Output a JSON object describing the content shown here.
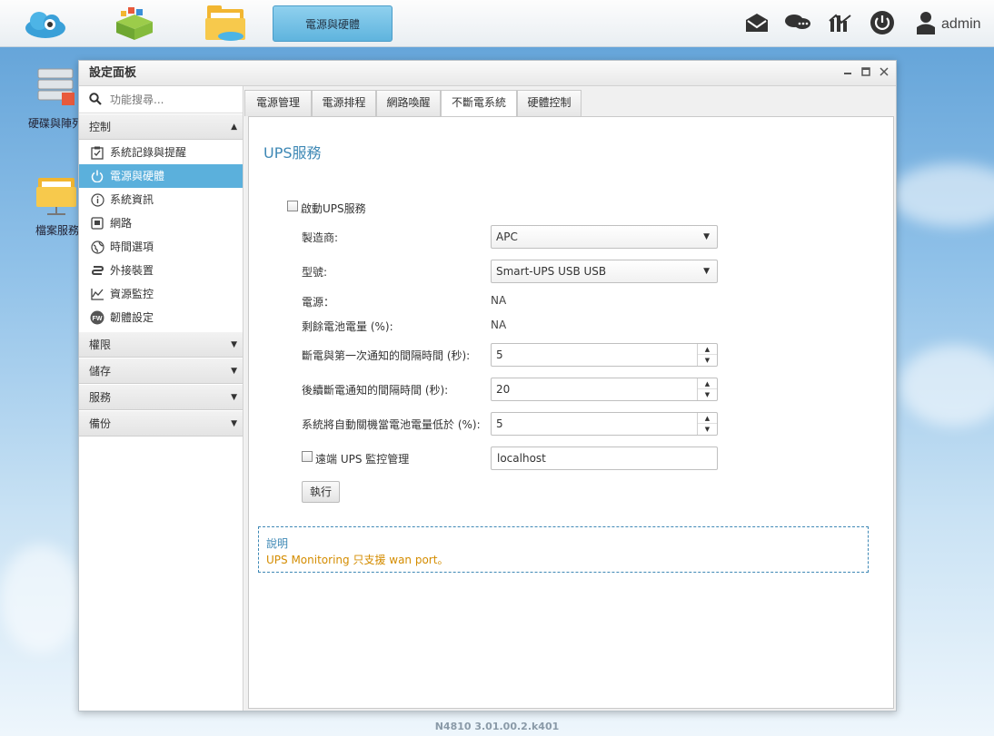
{
  "topbar": {
    "active_tab": "電源與硬體",
    "user": "admin"
  },
  "desktop": {
    "icon1_label": "硬碟與陣列",
    "icon2_label": "檔案服務"
  },
  "window": {
    "title": "設定面板"
  },
  "sidebar": {
    "search_placeholder": "功能搜尋...",
    "groups": [
      {
        "label": "控制"
      },
      {
        "label": "權限"
      },
      {
        "label": "儲存"
      },
      {
        "label": "服務"
      },
      {
        "label": "備份"
      }
    ],
    "items": [
      {
        "label": "系統記錄與提醒",
        "icon": "checklist-icon"
      },
      {
        "label": "電源與硬體",
        "icon": "power-icon"
      },
      {
        "label": "系統資訊",
        "icon": "info-icon"
      },
      {
        "label": "網路",
        "icon": "network-port-icon"
      },
      {
        "label": "時間選項",
        "icon": "globe-clock-icon"
      },
      {
        "label": "外接裝置",
        "icon": "usb-icon"
      },
      {
        "label": "資源監控",
        "icon": "chart-line-icon"
      },
      {
        "label": "韌體設定",
        "icon": "firmware-icon"
      }
    ]
  },
  "tabs": [
    {
      "label": "電源管理"
    },
    {
      "label": "電源排程"
    },
    {
      "label": "網路喚醒"
    },
    {
      "label": "不斷電系統"
    },
    {
      "label": "硬體控制"
    }
  ],
  "ups": {
    "title": "UPS服務",
    "enable_label": "啟動UPS服務",
    "vendor_label": "製造商:",
    "vendor_value": "APC",
    "model_label": "型號:",
    "model_value": "Smart-UPS USB USB",
    "power_label": "電源：",
    "power_value": "NA",
    "battery_label": "剩餘電池電量 (%):",
    "battery_value": "NA",
    "first_notify_label": "斷電與第一次通知的間隔時間 (秒):",
    "first_notify_value": "5",
    "next_notify_label": "後續斷電通知的間隔時間 (秒):",
    "next_notify_value": "20",
    "shutdown_label": "系統將自動關機當電池電量低於 (%):",
    "shutdown_value": "5",
    "remote_label": "遠端 UPS 監控管理",
    "remote_value": "localhost",
    "apply_label": "執行",
    "note_title": "說明",
    "note_text": "UPS Monitoring 只支援 wan port。"
  },
  "footer": "N4810   3.01.00.2.k401",
  "colors": {
    "accent": "#5bb0dc",
    "title_blue": "#3e88b5",
    "note_orange": "#d48c00"
  }
}
